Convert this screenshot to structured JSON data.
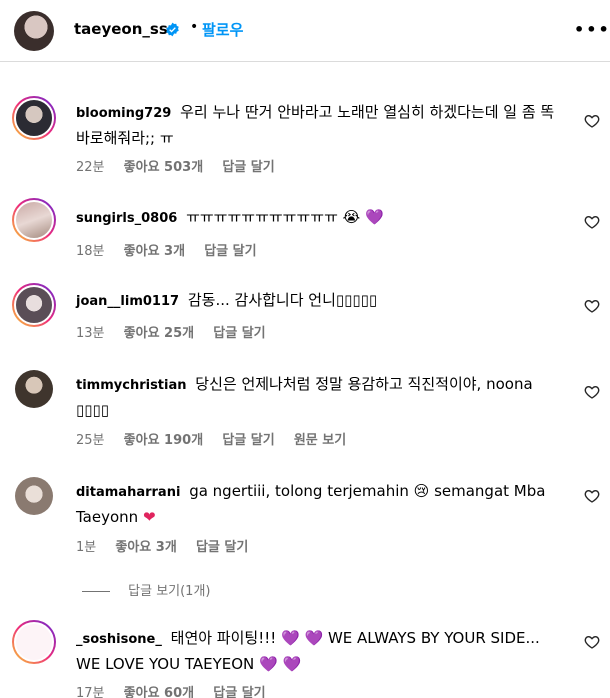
{
  "header": {
    "username": "taeyeon_ss",
    "dot": "•",
    "follow_label": "팔로우",
    "more_label": "•••"
  },
  "comments": [
    {
      "user": "blooming729",
      "text": "우리 누나 딴거 안바라고 노래만 열심히 하겠다는데 일 좀 똑바로해줘라;; ㅠ",
      "time": "22분",
      "likes": "좋아요 503개",
      "reply": "답글 달기"
    },
    {
      "user": "sungirls_0806",
      "text": "ㅠㅠㅠㅠㅠㅠㅠㅠㅠㅠㅠ",
      "emoji1": "😭",
      "emoji2": "💜",
      "time": "18분",
      "likes": "좋아요 3개",
      "reply": "답글 달기"
    },
    {
      "user": "joan__lim0117",
      "text": "감동... 감사합니다 언니▯▯▯▯▯",
      "time": "13분",
      "likes": "좋아요 25개",
      "reply": "답글 달기"
    },
    {
      "user": "timmychristian",
      "text": "당신은 언제나처럼 정말 용감하고 직진적이야, noona ▯▯▯▯",
      "time": "25분",
      "likes": "좋아요 190개",
      "reply": "답글 달기",
      "translate": "원문 보기"
    },
    {
      "user": "ditamaharrani",
      "text_a": "ga ngertiii, tolong terjemahin",
      "emoji1": "😢",
      "text_b": " semangat Mba Taeyonn",
      "emoji2": "❤",
      "time": "1분",
      "likes": "좋아요 3개",
      "reply": "답글 달기"
    },
    {
      "user": "_soshisone_",
      "text_a": "태연아 파이팅!!! ",
      "emoji1": "💜 💜",
      "text_b": " WE ALWAYS BY YOUR SIDE... WE LOVE YOU TAEYEON ",
      "emoji2": "💜 💜",
      "time": "17분",
      "likes": "좋아요 60개",
      "reply": "답글 달기"
    }
  ],
  "view_replies": "답글 보기(1개)",
  "colors": {
    "link_blue": "#0095f6",
    "meta_gray": "#737373",
    "divider": "#dbdbdb"
  }
}
